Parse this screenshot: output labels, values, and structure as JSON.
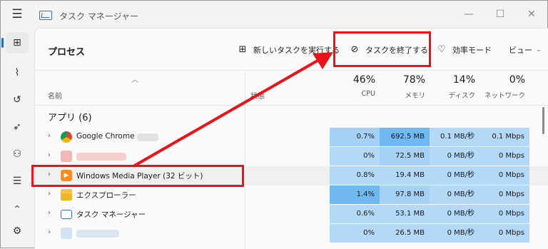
{
  "window": {
    "title": "タスク マネージャー",
    "menu_icon": "☰",
    "minimize": "—",
    "maximize": "☐",
    "close": "✕"
  },
  "sidebar": {
    "items": [
      {
        "icon": "processes-icon",
        "glyph": "⊞"
      },
      {
        "icon": "performance-icon",
        "glyph": "📈"
      },
      {
        "icon": "history-icon",
        "glyph": "↺"
      },
      {
        "icon": "startup-icon",
        "glyph": "➶"
      },
      {
        "icon": "users-icon",
        "glyph": "👥"
      },
      {
        "icon": "details-icon",
        "glyph": "☰"
      },
      {
        "icon": "services-icon",
        "glyph": "⌂"
      },
      {
        "icon": "settings-icon",
        "glyph": "⚙"
      }
    ]
  },
  "toolbar": {
    "title": "プロセス",
    "new_task": "新しいタスクを実行する",
    "end_task": "タスクを終了する",
    "efficiency": "効率モード",
    "view": "ビュー"
  },
  "header": {
    "name": "名前",
    "status": "状態",
    "cpu": {
      "pct": "46%",
      "label": "CPU"
    },
    "mem": {
      "pct": "78%",
      "label": "メモリ"
    },
    "disk": {
      "pct": "14%",
      "label": "ディスク"
    },
    "net": {
      "pct": "0%",
      "label": "ネットワーク"
    }
  },
  "group": {
    "label": "アプリ (6)"
  },
  "rows": [
    {
      "name": "Google Chrome",
      "cpu": "0.7%",
      "mem": "692.5 MB",
      "disk": "0.1 MB/秒",
      "net": "0.1 Mbps"
    },
    {
      "name": "",
      "cpu": "0%",
      "mem": "72.5 MB",
      "disk": "0 MB/秒",
      "net": "0 Mbps"
    },
    {
      "name": "Windows Media Player (32 ビット)",
      "cpu": "0.8%",
      "mem": "19.4 MB",
      "disk": "0 MB/秒",
      "net": "0 Mbps"
    },
    {
      "name": "エクスプローラー",
      "cpu": "1.4%",
      "mem": "97.8 MB",
      "disk": "0 MB/秒",
      "net": "0 Mbps"
    },
    {
      "name": "タスク マネージャー",
      "cpu": "0.6%",
      "mem": "53.1 MB",
      "disk": "0 MB/秒",
      "net": "0 Mbps"
    },
    {
      "name": "",
      "cpu": "0%",
      "mem": "26.5 MB",
      "disk": "0 MB/秒",
      "net": "0 Mbps"
    }
  ],
  "colors": {
    "highlight": "#e8141a",
    "accent": "#1e6fd1",
    "heat_light": "#b4d9f8",
    "heat_dark": "#6fb8f0"
  }
}
